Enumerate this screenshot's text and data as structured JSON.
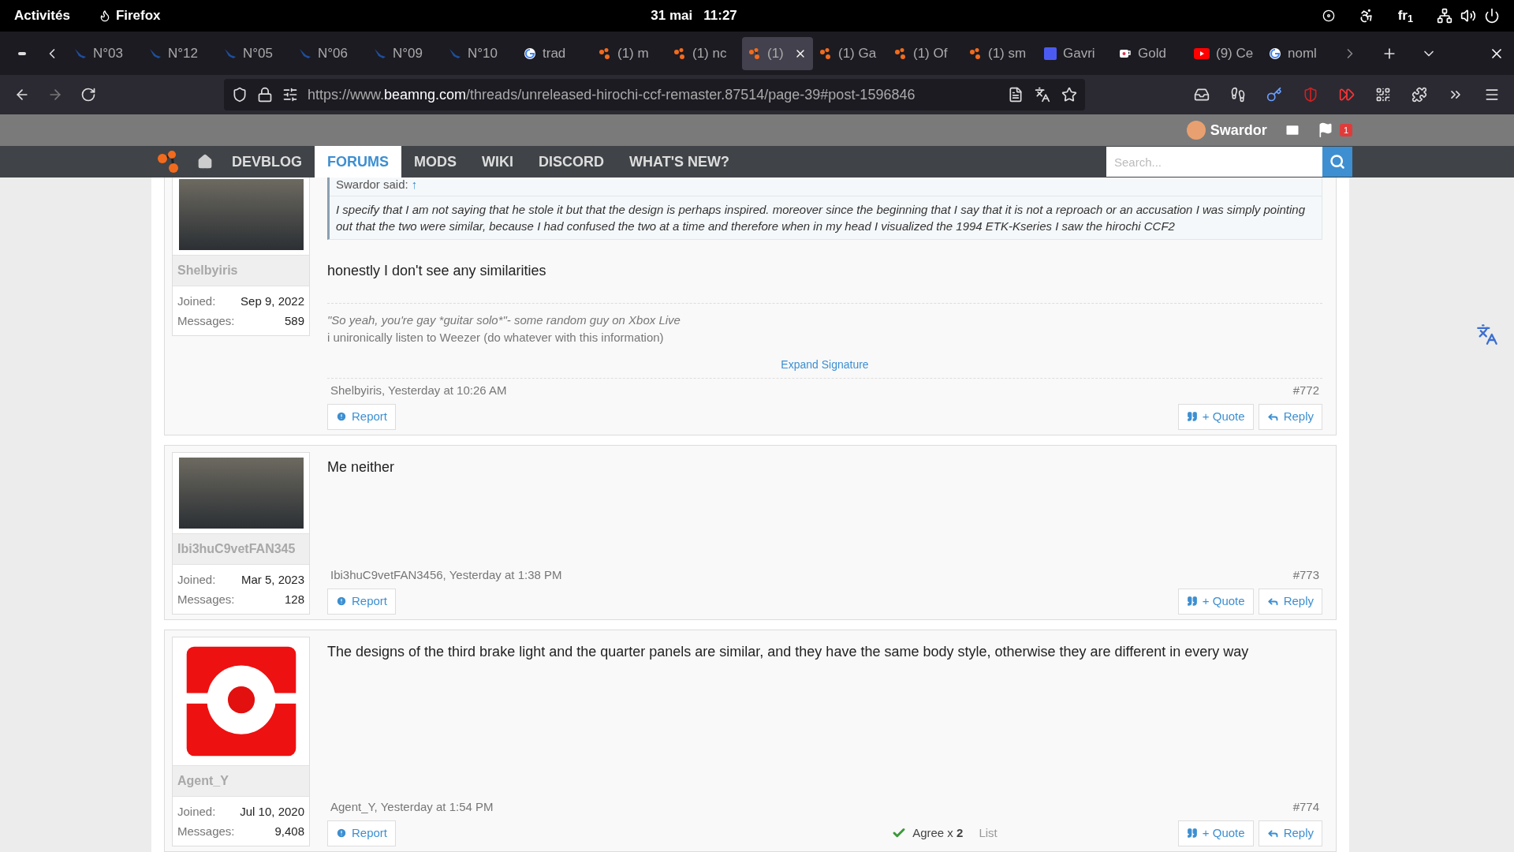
{
  "system_bar": {
    "activities": "Activités",
    "app": "Firefox",
    "date": "31 mai",
    "time": "11:27",
    "keyboard": "fr$_{1}$"
  },
  "tabs": [
    {
      "label": "N°03",
      "kind": "swoosh",
      "selected": false
    },
    {
      "label": "N°12",
      "kind": "swoosh",
      "selected": false
    },
    {
      "label": "N°05",
      "kind": "swoosh",
      "selected": false
    },
    {
      "label": "N°06",
      "kind": "swoosh",
      "selected": false
    },
    {
      "label": "N°09",
      "kind": "swoosh",
      "selected": false
    },
    {
      "label": "N°10",
      "kind": "swoosh",
      "selected": false
    },
    {
      "label": "trad",
      "kind": "google",
      "selected": false
    },
    {
      "label": "(1) m",
      "kind": "dots",
      "selected": false
    },
    {
      "label": "(1) nc",
      "kind": "dots",
      "selected": false
    },
    {
      "label": "(1)",
      "kind": "dots",
      "selected": true
    },
    {
      "label": "(1) Ga",
      "kind": "dots",
      "selected": false
    },
    {
      "label": "(1) Of",
      "kind": "dots",
      "selected": false
    },
    {
      "label": "(1) sm",
      "kind": "dots",
      "selected": false
    },
    {
      "label": "Gavri",
      "kind": "square",
      "selected": false
    },
    {
      "label": "Gold",
      "kind": "mug",
      "selected": false
    },
    {
      "label": "(9) Ce",
      "kind": "video",
      "selected": false
    },
    {
      "label": "noml",
      "kind": "google",
      "selected": false
    }
  ],
  "address_bar": {
    "prefix": "https://www.",
    "domain": "beamng.com",
    "path": "/threads/unreleased-hirochi-ccf-remaster.87514/page-39#post-1596846"
  },
  "site_header": {
    "username": "Swardor",
    "alerts": "1"
  },
  "site_nav": {
    "items": [
      {
        "label": "DEVBLOG",
        "selected": false
      },
      {
        "label": "FORUMS",
        "selected": true
      },
      {
        "label": "MODS",
        "selected": false
      },
      {
        "label": "WIKI",
        "selected": false
      },
      {
        "label": "DISCORD",
        "selected": false
      },
      {
        "label": "WHAT'S NEW?",
        "selected": false
      }
    ],
    "search": {
      "placeholder": "Search..."
    }
  },
  "posts": [
    {
      "avatar": {
        "kind": "photo"
      },
      "user": {
        "name": "Shelbyiris",
        "joined_label": "Joined:",
        "joined": "Sep 9, 2022",
        "messages_label": "Messages:",
        "messages": "589"
      },
      "quote": {
        "author": "Swardor said:",
        "arrow": "↑",
        "text": "I specify that I am not saying that he stole it but that the design is perhaps inspired. moreover since the beginning that I say that it is not a reproach or an accusation I was simply pointing out that the two were similar, because I had confused the two at a time and therefore when in my head I visualized the 1994 ETK-Kseries I saw the hirochi CCF2"
      },
      "message": "honestly I don't see any similarities",
      "signature": [
        "\"So yeah, you're gay *guitar solo*\"- some random guy on Xbox Live",
        "i unironically listen to Weezer (do whatever with this information)"
      ],
      "expand": "Expand Signature",
      "meta": "Shelbyiris, Yesterday at 10:26 AM",
      "number": "#772",
      "report": "Report",
      "quote_button": "+ Quote",
      "reply": "Reply"
    },
    {
      "avatar": {
        "kind": "photo"
      },
      "user": {
        "name": "Ibi3huC9vetFAN345",
        "joined_label": "Joined:",
        "joined": "Mar 5, 2023",
        "messages_label": "Messages:",
        "messages": "128"
      },
      "message": "Me neither",
      "meta": "Ibi3huC9vetFAN3456, Yesterday at 1:38 PM",
      "number": "#773",
      "report": "Report",
      "quote_button": "+ Quote",
      "reply": "Reply"
    },
    {
      "avatar": {
        "kind": "logo"
      },
      "user": {
        "name": "Agent_Y",
        "joined_label": "Joined:",
        "joined": "Jul 10, 2020",
        "messages_label": "Messages:",
        "messages": "9,408"
      },
      "message": "The designs of the third brake light and the quarter panels are similar, and they have the same body style, otherwise they are different in every way",
      "likes": {
        "text": "Agree x **2**",
        "list": "List"
      },
      "meta": "Agent_Y, Yesterday at 1:54 PM",
      "number": "#774",
      "report": "Report",
      "quote_button": "+ Quote",
      "reply": "Reply"
    }
  ]
}
